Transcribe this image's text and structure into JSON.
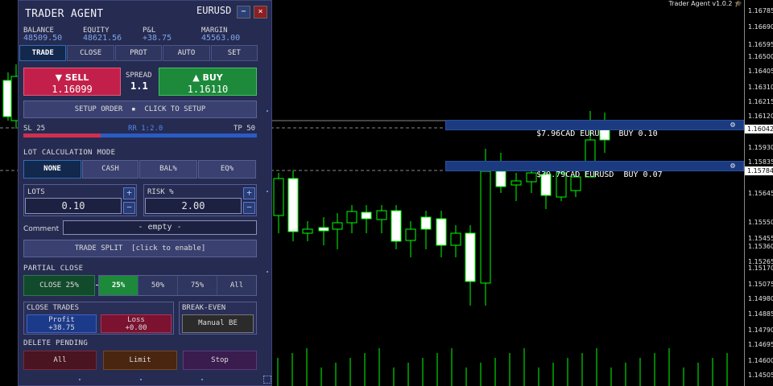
{
  "chart": {
    "title": "Trader Agent v1.0.2",
    "cap_icon": "graduation-cap-icon",
    "price_labels": [
      "1.16785",
      "1.16690",
      "1.16595",
      "1.16500",
      "1.16405",
      "1.16310",
      "1.16215",
      "1.16120",
      "1.16042",
      "1.15930",
      "1.15835",
      "1.15784",
      "1.15645",
      "1.15550",
      "1.15455",
      "1.15360",
      "1.15265",
      "1.15170",
      "1.15075",
      "1.14980",
      "1.14885",
      "1.14790",
      "1.14695",
      "1.14600",
      "1.14505"
    ],
    "price_tag_upper": "1.16042",
    "price_tag_lower": "1.15784",
    "positions": [
      {
        "text": "$7.96CAD EURUSD  BUY 0.10"
      },
      {
        "text": "$30.79CAD EURUSD  BUY 0.07"
      }
    ],
    "colors": {
      "bull": "#ffffff",
      "bear": "#000000",
      "wick": "#00ff00",
      "grid": "#888888",
      "position_bar": "#1c3a80"
    }
  },
  "panel": {
    "title": "TRADER AGENT",
    "symbol": "EURUSD",
    "minimize": "−",
    "close": "×",
    "stats": [
      {
        "label": "BALANCE",
        "value": "48509.50"
      },
      {
        "label": "EQUITY",
        "value": "48621.56"
      },
      {
        "label": "P&L",
        "value": "+38.75"
      },
      {
        "label": "MARGIN",
        "value": "45563.00"
      }
    ],
    "tabs": [
      "TRADE",
      "CLOSE",
      "PROT",
      "AUTO",
      "SET"
    ],
    "active_tab": "TRADE",
    "sell": {
      "label": "▼ SELL",
      "price": "1.16099"
    },
    "buy": {
      "label": "▲ BUY",
      "price": "1.16110"
    },
    "spread": {
      "label": "SPREAD",
      "value": "1.1"
    },
    "setup_order": "SETUP ORDER  ▪  CLICK TO SETUP",
    "sl_label": "SL 25",
    "rr_label": "RR 1:2.0",
    "tp_label": "TP 50",
    "lot_mode": {
      "title": "LOT CALCULATION MODE",
      "options": [
        "NONE",
        "CASH",
        "BAL%",
        "EQ%"
      ],
      "active": "NONE"
    },
    "lots": {
      "label": "LOTS",
      "value": "0.10"
    },
    "risk": {
      "label": "RISK %",
      "value": "2.00"
    },
    "plus": "+",
    "minus": "−",
    "comment": {
      "label": "Comment",
      "value": "- empty -"
    },
    "trade_split": "TRADE SPLIT  [click to enable]",
    "partial_close": {
      "title": "PARTIAL CLOSE",
      "close_label": "CLOSE  25%",
      "options": [
        "25%",
        "50%",
        "75%",
        "All"
      ],
      "active": "25%"
    },
    "close_trades": {
      "title": "CLOSE TRADES",
      "profit_label": "Profit",
      "profit_value": "+38.75",
      "loss_label": "Loss",
      "loss_value": "+0.00"
    },
    "break_even": {
      "title": "BREAK-EVEN",
      "button": "Manual BE"
    },
    "delete_pending": {
      "title": "DELETE PENDING",
      "all": "All",
      "limit": "Limit",
      "stop": "Stop"
    }
  }
}
